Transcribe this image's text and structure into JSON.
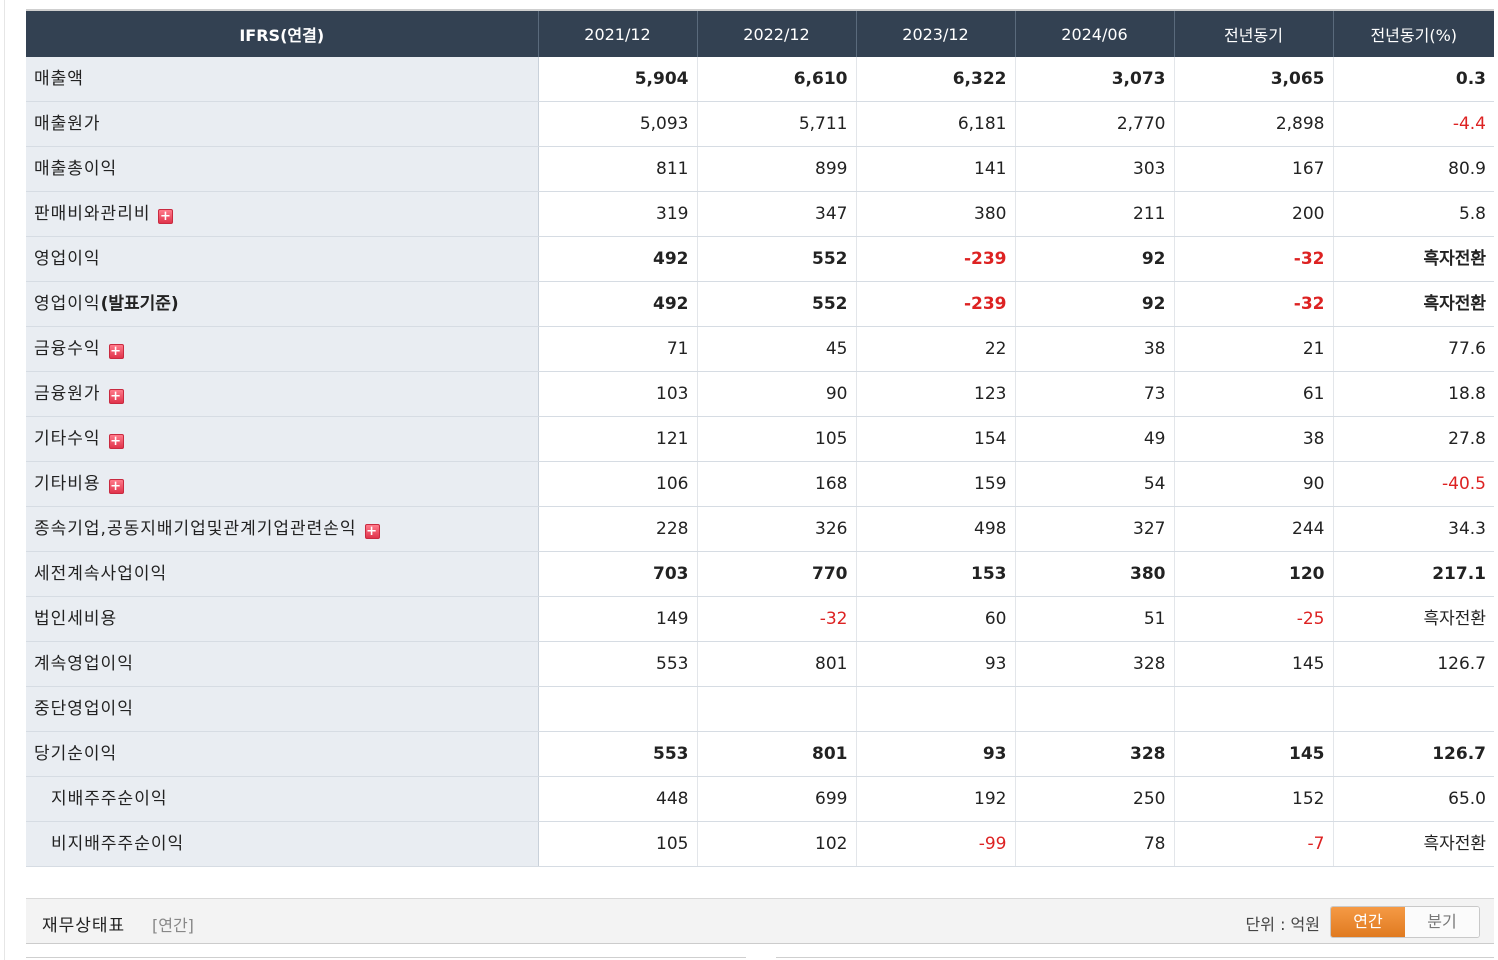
{
  "table": {
    "headers": [
      "IFRS(연결)",
      "2021/12",
      "2022/12",
      "2023/12",
      "2024/06",
      "전년동기",
      "전년동기(%)"
    ],
    "rows": [
      {
        "label": "매출액",
        "bold": true,
        "indent": false,
        "expand": false,
        "values": [
          "5,904",
          "6,610",
          "6,322",
          "3,073",
          "3,065",
          "0.3"
        ]
      },
      {
        "label": "매출원가",
        "bold": false,
        "indent": false,
        "expand": false,
        "values": [
          "5,093",
          "5,711",
          "6,181",
          "2,770",
          "2,898",
          "-4.4"
        ]
      },
      {
        "label": "매출총이익",
        "bold": false,
        "indent": false,
        "expand": false,
        "values": [
          "811",
          "899",
          "141",
          "303",
          "167",
          "80.9"
        ]
      },
      {
        "label": "판매비와관리비",
        "bold": false,
        "indent": false,
        "expand": true,
        "values": [
          "319",
          "347",
          "380",
          "211",
          "200",
          "5.8"
        ]
      },
      {
        "label": "영업이익",
        "bold": true,
        "indent": false,
        "expand": false,
        "values": [
          "492",
          "552",
          "-239",
          "92",
          "-32",
          "흑자전환"
        ]
      },
      {
        "label": "영업이익",
        "suffix": "(발표기준)",
        "bold": true,
        "indent": false,
        "expand": false,
        "values": [
          "492",
          "552",
          "-239",
          "92",
          "-32",
          "흑자전환"
        ]
      },
      {
        "label": "금융수익",
        "bold": false,
        "indent": false,
        "expand": true,
        "values": [
          "71",
          "45",
          "22",
          "38",
          "21",
          "77.6"
        ]
      },
      {
        "label": "금융원가",
        "bold": false,
        "indent": false,
        "expand": true,
        "values": [
          "103",
          "90",
          "123",
          "73",
          "61",
          "18.8"
        ]
      },
      {
        "label": "기타수익",
        "bold": false,
        "indent": false,
        "expand": true,
        "values": [
          "121",
          "105",
          "154",
          "49",
          "38",
          "27.8"
        ]
      },
      {
        "label": "기타비용",
        "bold": false,
        "indent": false,
        "expand": true,
        "values": [
          "106",
          "168",
          "159",
          "54",
          "90",
          "-40.5"
        ]
      },
      {
        "label": "종속기업,공동지배기업및관계기업관련손익",
        "bold": false,
        "indent": false,
        "expand": true,
        "values": [
          "228",
          "326",
          "498",
          "327",
          "244",
          "34.3"
        ]
      },
      {
        "label": "세전계속사업이익",
        "bold": true,
        "indent": false,
        "expand": false,
        "values": [
          "703",
          "770",
          "153",
          "380",
          "120",
          "217.1"
        ]
      },
      {
        "label": "법인세비용",
        "bold": false,
        "indent": false,
        "expand": false,
        "values": [
          "149",
          "-32",
          "60",
          "51",
          "-25",
          "흑자전환"
        ]
      },
      {
        "label": "계속영업이익",
        "bold": false,
        "indent": false,
        "expand": false,
        "values": [
          "553",
          "801",
          "93",
          "328",
          "145",
          "126.7"
        ]
      },
      {
        "label": "중단영업이익",
        "bold": false,
        "indent": false,
        "expand": false,
        "values": [
          "",
          "",
          "",
          "",
          "",
          ""
        ]
      },
      {
        "label": "당기순이익",
        "bold": true,
        "indent": false,
        "expand": false,
        "values": [
          "553",
          "801",
          "93",
          "328",
          "145",
          "126.7"
        ]
      },
      {
        "label": "지배주주순이익",
        "bold": false,
        "indent": true,
        "expand": false,
        "values": [
          "448",
          "699",
          "192",
          "250",
          "152",
          "65.0"
        ]
      },
      {
        "label": "비지배주주순이익",
        "bold": false,
        "indent": true,
        "expand": false,
        "values": [
          "105",
          "102",
          "-99",
          "78",
          "-7",
          "흑자전환"
        ]
      }
    ]
  },
  "section": {
    "title": "재무상태표",
    "sub": "[연간]",
    "unit": "단위 : 억원",
    "toggle_annual": "연간",
    "toggle_quarter": "분기"
  },
  "colors": {
    "header_bg": "#334152",
    "label_bg": "#e9edf2",
    "negative": "#dd2222",
    "accent": "#f0892e"
  },
  "icons": {
    "expand": "plus-icon"
  }
}
